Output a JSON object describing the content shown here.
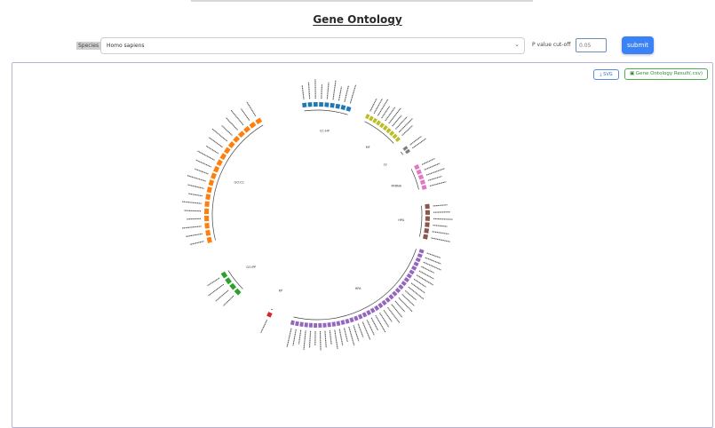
{
  "page": {
    "title": "Gene Ontology"
  },
  "controls": {
    "species_label": "Species",
    "species_value": "Homo sapiens",
    "pvalue_label": "P value cut-off",
    "pvalue_value": "0.05",
    "submit_label": "submit"
  },
  "toolbar": {
    "svg_label": "⤓ SVG",
    "csv_label": "Gene Ontology Result(.csv)"
  },
  "chart_data": {
    "type": "circular-bar",
    "groups": [
      {
        "name": "CC-HP",
        "color": "#1f77b4",
        "count": 9
      },
      {
        "name": "MF",
        "color": "#bcbd22",
        "count": 10
      },
      {
        "name": "TF",
        "color": "#7f7f7f",
        "count": 2
      },
      {
        "name": "MIRNA",
        "color": "#e377c2",
        "count": 5
      },
      {
        "name": "HPA",
        "color": "#8c564b",
        "count": 6
      },
      {
        "name": "HPA",
        "color": "#9467bd",
        "count": 36
      },
      {
        "name": "KP",
        "color": "#d62728",
        "count": 1
      },
      {
        "name": "GO:PP",
        "color": "#2ca02c",
        "count": 4
      },
      {
        "name": "GO:CC",
        "color": "#ff7f0e",
        "count": 20
      }
    ]
  }
}
